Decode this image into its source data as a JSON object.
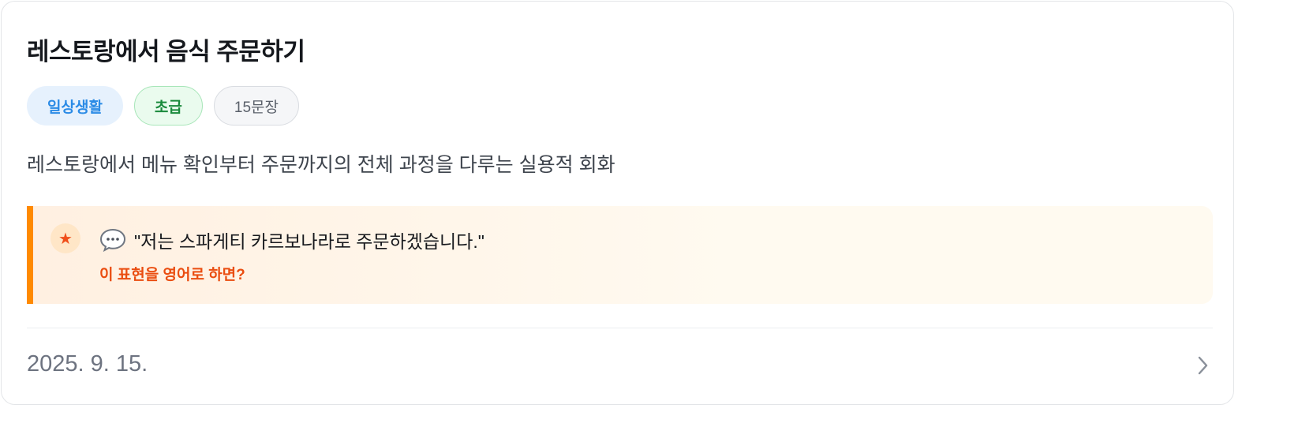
{
  "card": {
    "title": "레스토랑에서 음식 주문하기",
    "tags": [
      {
        "label": "일상생활",
        "color": "#2b8be6"
      },
      {
        "label": "초급",
        "color": "#1a8a3c"
      },
      {
        "label": "15문장",
        "color": "#5a606a"
      }
    ],
    "description": "레스토랑에서 메뉴 확인부터 주문까지의 전체 과정을 다루는 실용적 회화",
    "highlight": {
      "icon": "star-icon",
      "bubble_icon": "speech-bubble-icon",
      "quote": "\"저는 스파게티 카르보나라로 주문하겠습니다.\"",
      "prompt": "이 표현을 영어로 하면?",
      "accent_color": "#ff8a00"
    },
    "date": "2025. 9. 15.",
    "chevron_icon": "chevron-right-icon"
  }
}
